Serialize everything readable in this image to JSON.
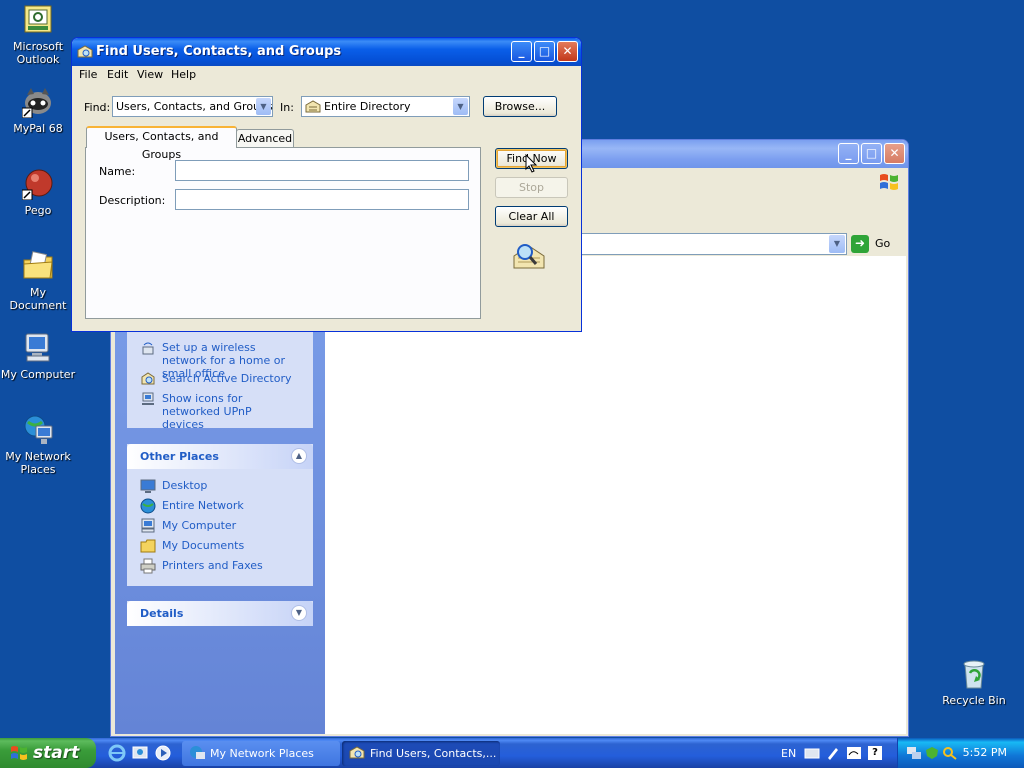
{
  "desktop": {
    "icons": [
      {
        "label": "Microsoft Outlook",
        "icon": "outlook-icon"
      },
      {
        "label": "MyPal 68",
        "icon": "mypal-icon"
      },
      {
        "label": "Pego",
        "icon": "pego-icon"
      },
      {
        "label": "My Document",
        "icon": "my-documents-icon"
      },
      {
        "label": "My Computer",
        "icon": "my-computer-icon"
      },
      {
        "label": "My Network Places",
        "icon": "network-places-icon"
      },
      {
        "label": "Recycle Bin",
        "icon": "recycle-bin-icon"
      }
    ]
  },
  "network_window": {
    "address_go": "Go",
    "tasks": [
      {
        "label": "Set up a wireless network for a home or small office",
        "icon": "wireless-setup-icon"
      },
      {
        "label": "Search Active Directory",
        "icon": "search-directory-icon"
      },
      {
        "label": "Show icons for networked UPnP devices",
        "icon": "upnp-icon"
      }
    ],
    "other_places_title": "Other Places",
    "other_places": [
      {
        "label": "Desktop",
        "icon": "desktop-icon"
      },
      {
        "label": "Entire Network",
        "icon": "entire-network-icon"
      },
      {
        "label": "My Computer",
        "icon": "my-computer-icon"
      },
      {
        "label": "My Documents",
        "icon": "my-documents-icon"
      },
      {
        "label": "Printers and Faxes",
        "icon": "printer-icon"
      }
    ],
    "details_title": "Details"
  },
  "find_dialog": {
    "title": "Find Users, Contacts, and Groups",
    "menu": [
      "File",
      "Edit",
      "View",
      "Help"
    ],
    "find_label": "Find:",
    "find_value": "Users, Contacts, and Groups",
    "in_label": "In:",
    "in_value": "Entire Directory",
    "browse_label": "Browse...",
    "tabs": [
      "Users, Contacts, and Groups",
      "Advanced"
    ],
    "name_label": "Name:",
    "description_label": "Description:",
    "name_value": "",
    "description_value": "",
    "find_now_label": "Find Now",
    "stop_label": "Stop",
    "clear_all_label": "Clear All"
  },
  "taskbar": {
    "start_label": "start",
    "items": [
      {
        "label": "My Network Places",
        "active": false
      },
      {
        "label": "Find Users, Contacts,...",
        "active": true
      }
    ],
    "language": "EN",
    "clock": "5:52 PM"
  },
  "colors": {
    "desktop": "#0f4ea2",
    "title_active": "#0a5de8",
    "task_link": "#215dc6",
    "start_green": "#3a9d3a"
  }
}
